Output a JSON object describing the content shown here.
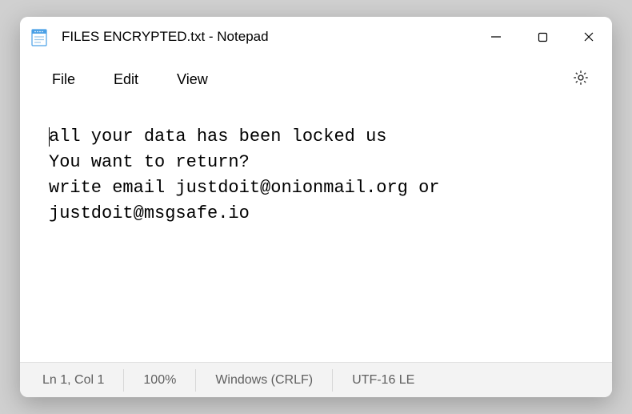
{
  "titlebar": {
    "title": "FILES ENCRYPTED.txt - Notepad"
  },
  "menubar": {
    "file": "File",
    "edit": "Edit",
    "view": "View"
  },
  "editor": {
    "content": "all your data has been locked us\nYou want to return?\nwrite email justdoit@onionmail.org or justdoit@msgsafe.io"
  },
  "statusbar": {
    "position": "Ln 1, Col 1",
    "zoom": "100%",
    "line_ending": "Windows (CRLF)",
    "encoding": "UTF-16 LE"
  }
}
